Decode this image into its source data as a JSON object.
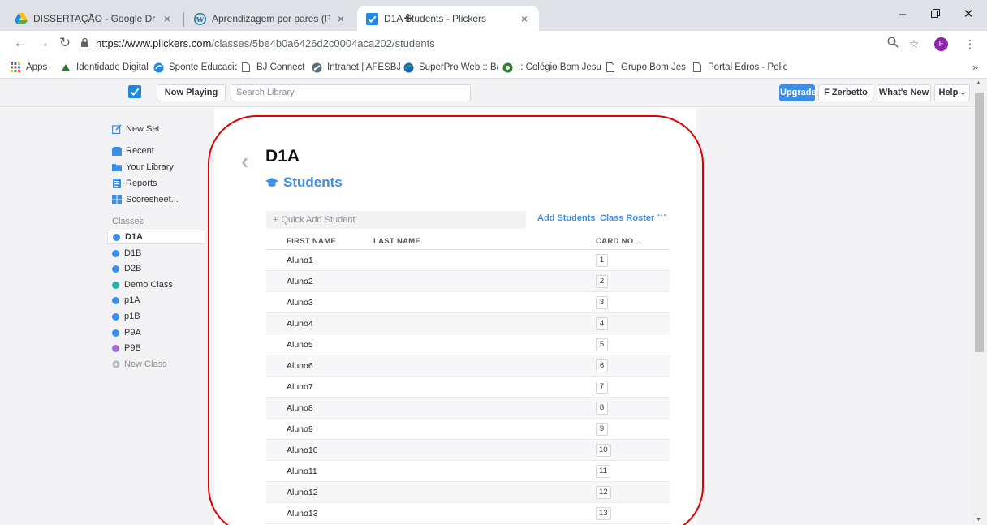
{
  "browser": {
    "tabs": [
      {
        "title": "DISSERTAÇÃO - Google Drive",
        "icon": "google-drive-icon"
      },
      {
        "title": "Aprendizagem por pares (Peer In",
        "icon": "wordpress-icon"
      },
      {
        "title": "D1A Students - Plickers",
        "icon": "plickers-icon"
      }
    ],
    "url_host": "https://www.plickers.com",
    "url_path": "/classes/5be4b0a6426d2c0004aca202/students",
    "profile_initial": "F",
    "bookmarks": [
      {
        "label": "Apps",
        "icon": "apps-grid-icon"
      },
      {
        "label": "Identidade Digital Pa",
        "icon": "identidade-icon"
      },
      {
        "label": "Sponte Educacional \\",
        "icon": "sponte-icon"
      },
      {
        "label": "BJ Connect",
        "icon": "page-icon"
      },
      {
        "label": "Intranet | AFESBJ & C",
        "icon": "intranet-icon"
      },
      {
        "label": "SuperPro Web :: Banc",
        "icon": "superpro-icon"
      },
      {
        "label": ":: Colégio Bom Jesus |",
        "icon": "colegio-icon"
      },
      {
        "label": "Grupo Bom Jesus - F",
        "icon": "page-icon"
      },
      {
        "label": "Portal Edros - Poliedr",
        "icon": "page-icon"
      }
    ],
    "bookmarks_more": "»"
  },
  "plickers_nav": {
    "now_playing": "Now Playing",
    "search_placeholder": "Search Library",
    "upgrade": "Upgrade",
    "user": "F Zerbetto",
    "whats_new": "What's New",
    "help": "Help"
  },
  "sidebar": {
    "new_set": "New Set",
    "items": [
      {
        "label": "Recent",
        "icon": "recent-icon"
      },
      {
        "label": "Your Library",
        "icon": "folder-icon"
      },
      {
        "label": "Reports",
        "icon": "reports-icon"
      },
      {
        "label": "Scoresheet...",
        "icon": "scoresheet-icon"
      }
    ],
    "classes_heading": "Classes",
    "classes": [
      {
        "label": "D1A",
        "color": "#3c8ee6",
        "active": true
      },
      {
        "label": "D1B",
        "color": "#3c8ee6"
      },
      {
        "label": "D2B",
        "color": "#3c8ee6"
      },
      {
        "label": "Demo Class",
        "color": "#22b5a8"
      },
      {
        "label": "p1A",
        "color": "#3c8ee6"
      },
      {
        "label": "p1B",
        "color": "#3c8ee6"
      },
      {
        "label": "P9A",
        "color": "#3c8ee6"
      },
      {
        "label": "P9B",
        "color": "#a36bd6"
      }
    ],
    "new_class": "New Class"
  },
  "main": {
    "class_name": "D1A",
    "section_title": "Students",
    "quick_add_placeholder": "Quick Add Student",
    "add_students": "Add Students",
    "class_roster": "Class Roster",
    "more": "···",
    "columns": {
      "first_name": "FIRST NAME",
      "last_name": "LAST NAME",
      "card_no": "CARD NO"
    },
    "students": [
      {
        "first": "Aluno1",
        "card": "1"
      },
      {
        "first": "Aluno2",
        "card": "2"
      },
      {
        "first": "Aluno3",
        "card": "3"
      },
      {
        "first": "Aluno4",
        "card": "4"
      },
      {
        "first": "Aluno5",
        "card": "5"
      },
      {
        "first": "Aluno6",
        "card": "6"
      },
      {
        "first": "Aluno7",
        "card": "7"
      },
      {
        "first": "Aluno8",
        "card": "8"
      },
      {
        "first": "Aluno9",
        "card": "9"
      },
      {
        "first": "Aluno10",
        "card": "10"
      },
      {
        "first": "Aluno11",
        "card": "11"
      },
      {
        "first": "Aluno12",
        "card": "12"
      },
      {
        "first": "Aluno13",
        "card": "13"
      }
    ]
  },
  "colors": {
    "accent": "#3c8ee6",
    "annotation": "#e00000"
  }
}
